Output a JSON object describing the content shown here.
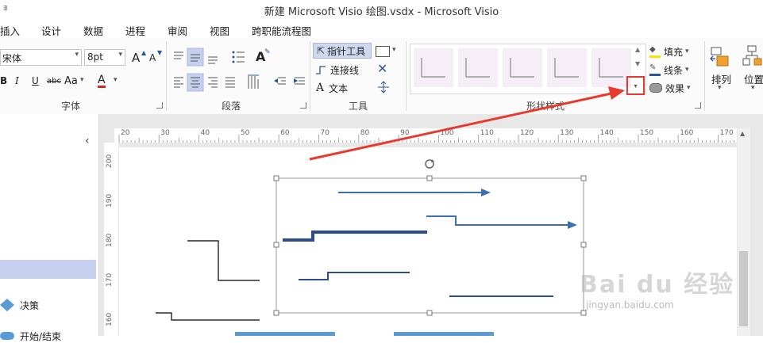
{
  "window": {
    "title": "新建 Microsoft Visio 绘图.vsdx - Microsoft Visio",
    "qat_icon": "ⱻ"
  },
  "tabs": [
    "插入",
    "设计",
    "数据",
    "进程",
    "审阅",
    "视图",
    "跨职能流程图"
  ],
  "font_group": {
    "font_name": "宋体",
    "font_size": "8pt",
    "grow_font": "A",
    "shrink_font": "A",
    "bold": "B",
    "italic": "I",
    "underline": "U",
    "strikethrough": "abc",
    "case": "Aa",
    "font_color": "A",
    "label": "字体"
  },
  "paragraph_group": {
    "label": "段落",
    "format_text": "A"
  },
  "tools_group": {
    "pointer_tool": "指针工具",
    "connector": "连接线",
    "text": "文本",
    "label": "工具"
  },
  "shape_styles_group": {
    "label": "形状样式",
    "fill": "填充",
    "line": "线条",
    "effects": "效果"
  },
  "arrange_group": {
    "arrange": "排列",
    "position": "位置"
  },
  "sidebar": {
    "collapse": "‹",
    "items": [
      "决策",
      "开始/结束"
    ]
  },
  "ruler": {
    "h_ticks": [
      "20",
      "30",
      "40",
      "50",
      "60",
      "70",
      "80",
      "90",
      "100",
      "110",
      "120",
      "130",
      "140",
      "150",
      "160",
      "170"
    ],
    "v_ticks": [
      "200",
      "190",
      "180",
      "170",
      "160"
    ]
  },
  "watermark": {
    "brand": "Bai du 经验",
    "url": "jingyan.baidu.com"
  },
  "colors": {
    "accent": "#2b579a",
    "annotation_red": "#e8392f",
    "connector_blue": "#3b6fb6",
    "selected_tab": "#c5cfee"
  }
}
